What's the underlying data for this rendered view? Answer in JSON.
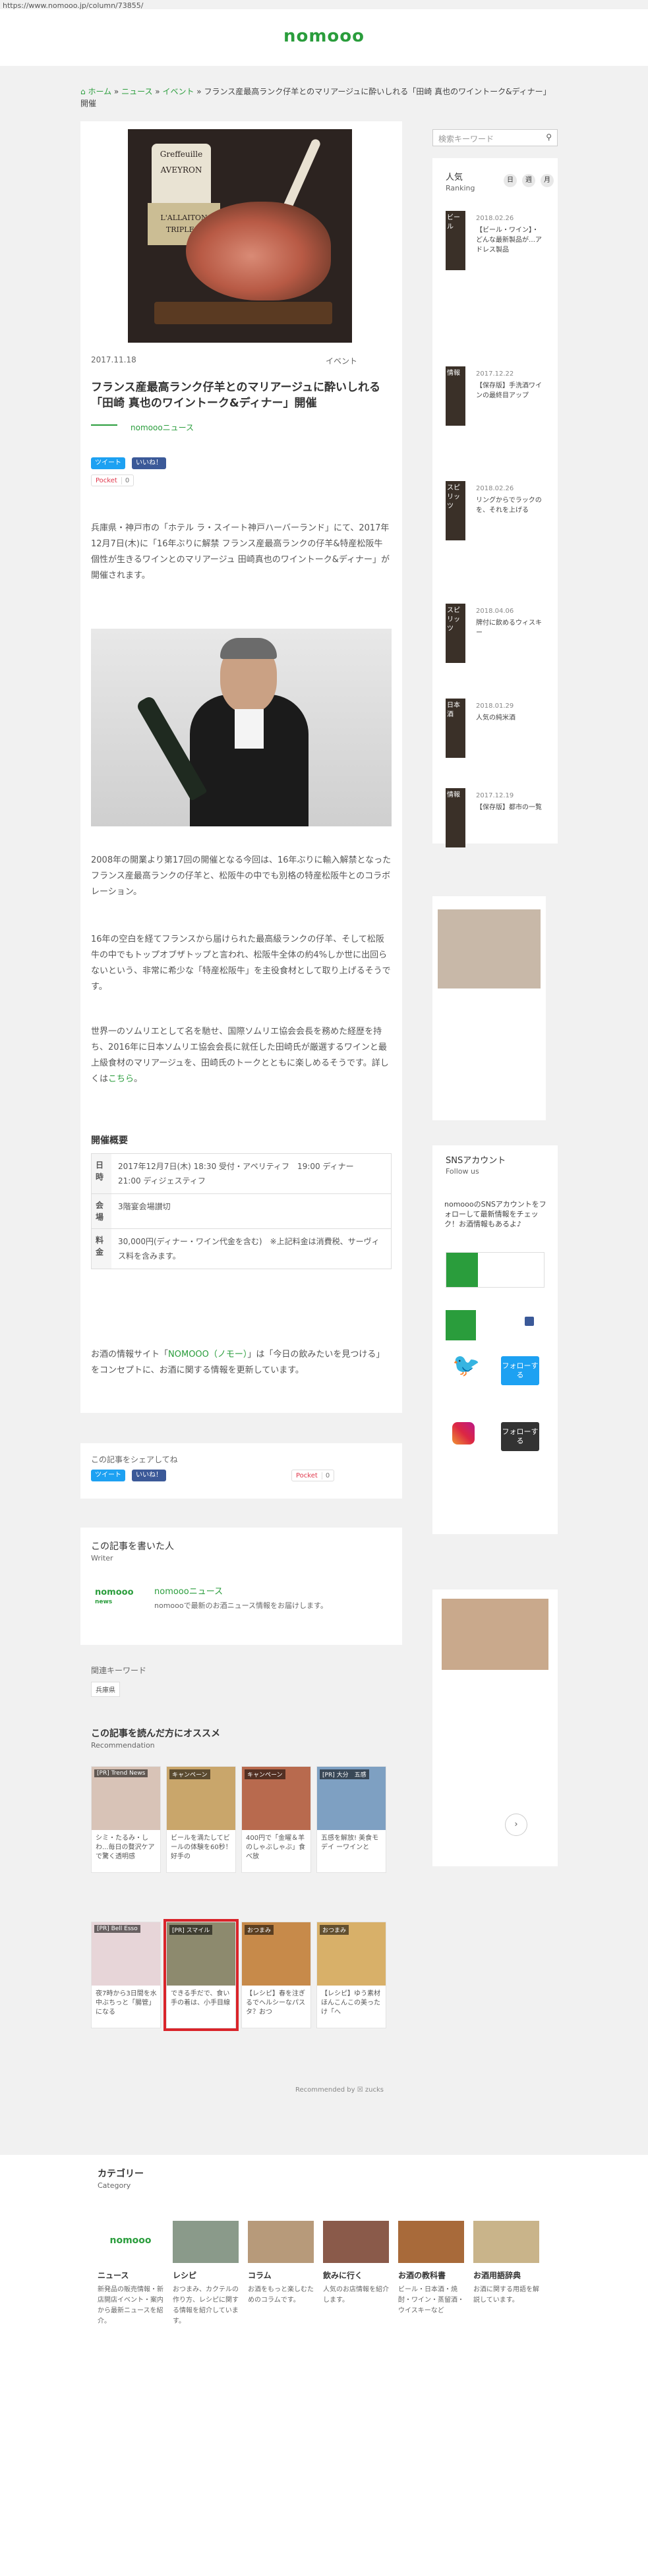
{
  "url": "https://www.nomooo.jp/column/73855/",
  "site": {
    "logo": "nomooo"
  },
  "breadcrumb": {
    "home": "ホーム",
    "sep": " » ",
    "news": "ニュース",
    "event": "イベント",
    "current": "フランス産最高ランク仔羊とのマリアージュに酔いしれる「田崎 真也のワイントーク&ディナー」開催"
  },
  "article": {
    "hero": {
      "brand1": "Greffeuille",
      "brand2": "AVEYRON",
      "label1": "L'ALLAITON",
      "label2": "TRIPLE A"
    },
    "date": "2017.11.18",
    "category": "イベント",
    "title": "フランス産最高ランク仔羊とのマリアージュに酔いしれる「田崎 真也のワイントーク&ディナー」開催",
    "author": "nomoooニュース",
    "share": {
      "tweet": "ツイート",
      "like": "いいね！",
      "pocket": "Pocket",
      "pocket_count": "0"
    },
    "p1": "兵庫県・神戸市の「ホテル ラ・スイート神戸ハーバーランド」にて、2017年12月7日(木)に「16年ぶりに解禁 フランス産最高ランクの仔羊&特産松阪牛 個性が生きるワインとのマリアージュ 田崎真也のワイントーク&ディナー」が開催されます。",
    "p2": "2008年の開業より第17回の開催となる今回は、16年ぶりに輸入解禁となったフランス産最高ランクの仔羊と、松阪牛の中でも別格の特産松阪牛とのコラボレーション。",
    "p3": "16年の空白を経てフランスから届けられた最高級ランクの仔羊、そして松阪牛の中でもトップオブザトップと言われ、松阪牛全体の約4%しか世に出回らないという、非常に希少な「特産松阪牛」を主役食材として取り上げるそうです。",
    "p4a": "世界一のソムリエとして名を馳せ、国際ソムリエ協会会長を務めた経歴を持ち、2016年に日本ソムリエ協会会長に就任した田崎氏が厳選するワインと最上級食材のマリアージュを、田崎氏のトークとともに楽しめるそうです。詳しくは",
    "p4link": "こちら",
    "p4b": "。",
    "overview_title": "開催概要",
    "table": [
      {
        "h": "日時",
        "v": "2017年12月7日(木) 18:30 受付・アペリティフ　19:00 ディナー　21:00 ディジェスティフ"
      },
      {
        "h": "会場",
        "v": "3階宴会場讃切"
      },
      {
        "h": "料金",
        "v": "30,000円(ディナー・ワイン代金を含む)　※上記料金は消費税、サーヴィス料を含みます。"
      }
    ],
    "p5a": "お酒の情報サイト「",
    "p5link": "NOMOOO（ノモー）",
    "p5b": "」は「今日の飲みたいを見つける」をコンセプトに、お酒に関する情報を更新しています。"
  },
  "sharebox": {
    "label": "この記事をシェアしてね"
  },
  "writer": {
    "title": "この記事を書いた人",
    "sub": "Writer",
    "name": "nomoooニュース",
    "desc": "nomoooで最新のお酒ニュース情報をお届けします。",
    "logo": "nomooo",
    "logo_small": "news"
  },
  "keywords": {
    "title": "関連キーワード",
    "tag": "兵庫県"
  },
  "recommend": {
    "title": "この記事を読んだ方にオススメ",
    "sub": "Recommendation",
    "by": "Recommended by ☒ zucks",
    "items": [
      {
        "badge": "[PR] Trend News",
        "cap": "シミ・たるみ・しわ...毎日の贅沢ケアで驚く透明感",
        "color": "#d8c3b7"
      },
      {
        "badge": "キャンペーン",
        "cap": "ビールを満たしてビールの体験を60秒！ 好手の",
        "color": "#c9a66b"
      },
      {
        "badge": "キャンペーン",
        "cap": "400円で「金曜＆羊のしゃぶしゃぶ」食べ放",
        "color": "#b86a4e"
      },
      {
        "badge": "[PR] 大分　五感",
        "cap": "五感を解放! 美食モデイ ーワインと",
        "color": "#7ea0c2"
      },
      {
        "badge": "[PR] Bell Esso",
        "cap": "夜7時から3日間を水中ぶちっと「腸管」になる",
        "color": "#e7d5d8"
      },
      {
        "badge": "[PR] スマイル",
        "cap": "できる手だで、食い手の着は、小手目線",
        "color": "#8d8a6e"
      },
      {
        "badge": "おつまみ",
        "cap": "【レシピ】春を注ぎるでヘルシーなパスタ？おつ",
        "color": "#c78a4a"
      },
      {
        "badge": "おつまみ",
        "cap": "【レシピ】ゆう素材ほんこんこの美ったけ「へ",
        "color": "#d8b069"
      }
    ]
  },
  "sidebar": {
    "search_placeholder": "検索キーワード",
    "ranking": {
      "title": "人気",
      "sub": "Ranking",
      "tabs": [
        "日",
        "週",
        "月"
      ],
      "items": [
        {
          "thumb": "ビール",
          "date": "2018.02.26",
          "text": "【ビール・ワイン】・どんな最新製品が…アドレス製品"
        },
        {
          "thumb": "情報",
          "date": "2017.12.22",
          "text": "【保存版】手洗酒ワインの最終目アップ"
        },
        {
          "thumb": "スピリッツ",
          "date": "2018.02.26",
          "text": "リングからでラックのを、それを上げる"
        },
        {
          "thumb": "スピリッツ",
          "date": "2018.04.06",
          "text": "牌付に飲めるウィスキー"
        },
        {
          "thumb": "日本酒",
          "date": "2018.01.29",
          "text": "人気の純米酒"
        },
        {
          "thumb": "情報",
          "date": "2017.12.19",
          "text": "【保存版】都市の一覧"
        }
      ]
    },
    "sns": {
      "title": "SNSアカウント",
      "sub": "Follow us",
      "desc": "nomoooのSNSアカウントをフォローして最新情報をチェック！お酒情報もあるよ♪",
      "follow": "フォローする"
    }
  },
  "footer": {
    "title": "カテゴリー",
    "sub": "Category",
    "cats": [
      {
        "name": "ニュース",
        "desc": "新発品の販売情報・新店開店イベント・案内から最新ニュースを紹介。"
      },
      {
        "name": "レシピ",
        "desc": "おつまみ、カクテルの作り方、レシピに関する情報を紹介しています。"
      },
      {
        "name": "コラム",
        "desc": "お酒をもっと楽しむためのコラムです。"
      },
      {
        "name": "飲みに行く",
        "desc": "人気のお店情報を紹介します。"
      },
      {
        "name": "お酒の教科書",
        "desc": "ビール・日本酒・焼酎・ワイン・蒸留酒・ウイスキーなど"
      },
      {
        "name": "お酒用語辞典",
        "desc": "お酒に関する用語を解説しています。"
      }
    ]
  }
}
